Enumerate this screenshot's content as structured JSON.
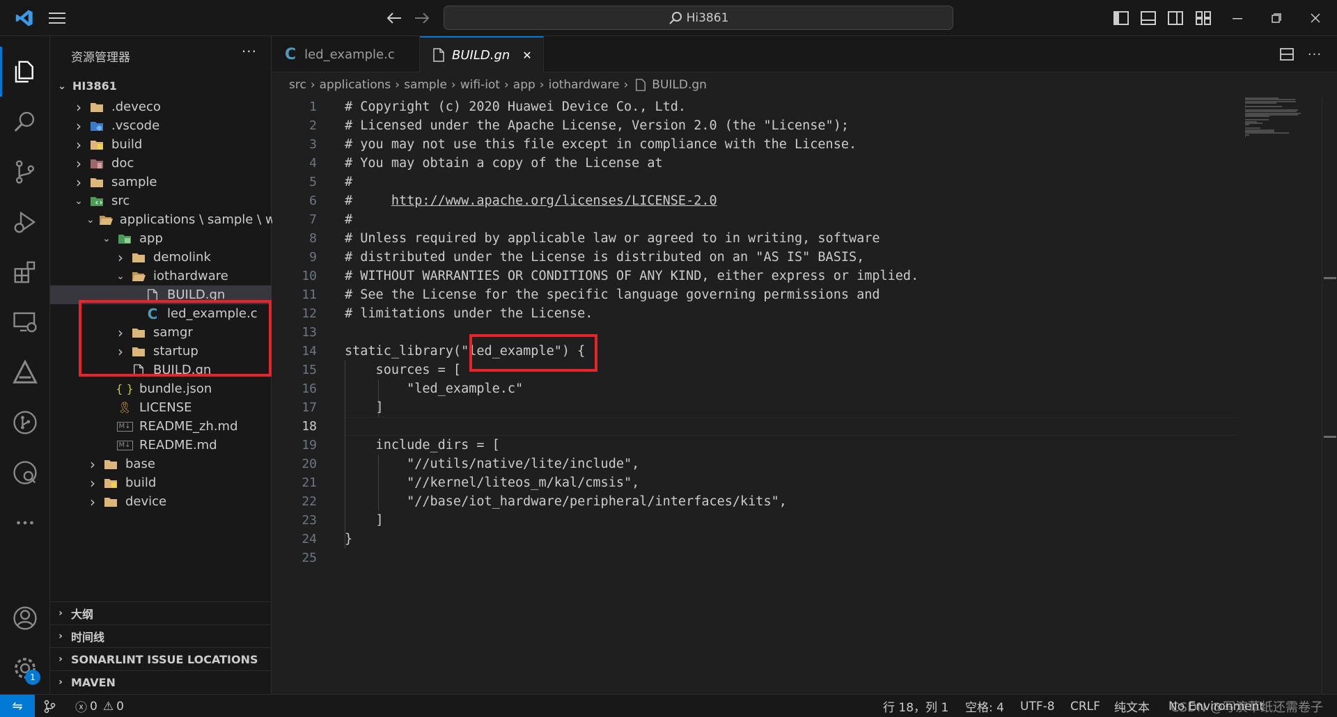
{
  "titlebar": {
    "search_text": "Hi3861",
    "menu_icon": "hamburger-menu-icon",
    "back_icon": "arrow-left-icon",
    "forward_icon": "arrow-right-icon"
  },
  "sidebar": {
    "title": "资源管理器",
    "more": "···",
    "root": "HI3861",
    "tree": [
      {
        "label": ".deveco",
        "depth": 1,
        "kind": "folder",
        "expanded": false
      },
      {
        "label": ".vscode",
        "depth": 1,
        "kind": "folder-vscode",
        "expanded": false
      },
      {
        "label": "build",
        "depth": 1,
        "kind": "folder-build",
        "expanded": false
      },
      {
        "label": "doc",
        "depth": 1,
        "kind": "folder-doc",
        "expanded": false
      },
      {
        "label": "sample",
        "depth": 1,
        "kind": "folder",
        "expanded": false
      },
      {
        "label": "src",
        "depth": 1,
        "kind": "folder-src",
        "expanded": true
      },
      {
        "label": "applications \\ sample \\ w...",
        "depth": 2,
        "kind": "folder-open",
        "expanded": true
      },
      {
        "label": "app",
        "depth": 3,
        "kind": "folder-app",
        "expanded": true
      },
      {
        "label": "demolink",
        "depth": 4,
        "kind": "folder",
        "expanded": false
      },
      {
        "label": "iothardware",
        "depth": 4,
        "kind": "folder-open",
        "expanded": true
      },
      {
        "label": "BUILD.gn",
        "depth": 5,
        "kind": "file",
        "selected": true
      },
      {
        "label": "led_example.c",
        "depth": 5,
        "kind": "c-file"
      },
      {
        "label": "samgr",
        "depth": 4,
        "kind": "folder",
        "expanded": false
      },
      {
        "label": "startup",
        "depth": 4,
        "kind": "folder",
        "expanded": false
      },
      {
        "label": "BUILD.gn",
        "depth": 4,
        "kind": "file",
        "leaf": true
      },
      {
        "label": "bundle.json",
        "depth": 3,
        "kind": "json",
        "leaf": true
      },
      {
        "label": "LICENSE",
        "depth": 3,
        "kind": "license",
        "leaf": true
      },
      {
        "label": "README_zh.md",
        "depth": 3,
        "kind": "md",
        "leaf": true
      },
      {
        "label": "README.md",
        "depth": 3,
        "kind": "md",
        "leaf": true
      },
      {
        "label": "base",
        "depth": 2,
        "kind": "folder",
        "expanded": false
      },
      {
        "label": "build",
        "depth": 2,
        "kind": "folder-build",
        "expanded": false
      },
      {
        "label": "device",
        "depth": 2,
        "kind": "folder",
        "expanded": false
      }
    ],
    "sections": [
      "大纲",
      "时间线",
      "SONARLINT ISSUE LOCATIONS",
      "MAVEN"
    ]
  },
  "tabs": [
    {
      "label": "led_example.c",
      "active": false,
      "icon": "c-language-icon"
    },
    {
      "label": "BUILD.gn",
      "active": true,
      "icon": "file-icon",
      "close": "✕"
    }
  ],
  "breadcrumb": [
    "src",
    "applications",
    "sample",
    "wifi-iot",
    "app",
    "iothardware",
    "BUILD.gn"
  ],
  "editor": {
    "current_line": 18,
    "lines": [
      "# Copyright (c) 2020 Huawei Device Co., Ltd.",
      "# Licensed under the Apache License, Version 2.0 (the \"License\");",
      "# you may not use this file except in compliance with the License.",
      "# You may obtain a copy of the License at",
      "#",
      "#     http://www.apache.org/licenses/LICENSE-2.0",
      "#",
      "# Unless required by applicable law or agreed to in writing, software",
      "# distributed under the License is distributed on an \"AS IS\" BASIS,",
      "# WITHOUT WARRANTIES OR CONDITIONS OF ANY KIND, either express or implied.",
      "# See the License for the specific language governing permissions and",
      "# limitations under the License.",
      "",
      "static_library(\"led_example\") {",
      "    sources = [",
      "        \"led_example.c\"",
      "    ]",
      "",
      "    include_dirs = [",
      "        \"//utils/native/lite/include\",",
      "        \"//kernel/liteos_m/kal/cmsis\",",
      "        \"//base/iot_hardware/peripheral/interfaces/kits\",",
      "    ]",
      "}",
      ""
    ]
  },
  "statusbar": {
    "errors": "0",
    "warnings": "0",
    "position": "行 18，列 1",
    "spaces": "空格: 4",
    "encoding": "UTF-8",
    "eol": "CRLF",
    "language": "纯文本",
    "environment": "No Environment",
    "watermark": "CSDN @写演草纸还需卷子"
  },
  "colors": {
    "accent": "#0078d4",
    "highlight_box": "#e8232a",
    "folder": "#dcb67a"
  }
}
